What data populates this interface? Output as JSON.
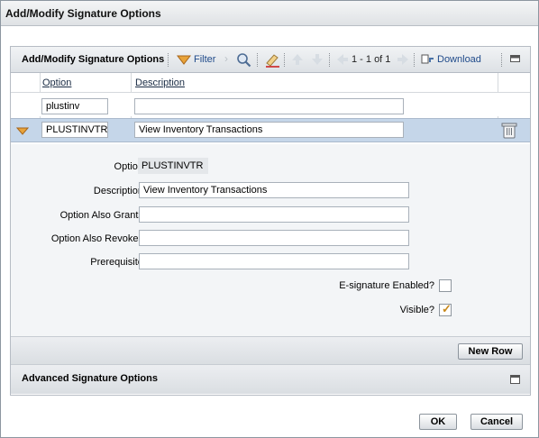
{
  "dialog": {
    "title": "Add/Modify Signature Options"
  },
  "toolbar": {
    "title": "Add/Modify Signature Options",
    "filter_label": "Filter",
    "pagination": "1 - 1 of 1",
    "download_label": "Download"
  },
  "columns": {
    "option": "Option",
    "description": "Description"
  },
  "filter_row": {
    "option": "plustinv",
    "description": ""
  },
  "selected_row": {
    "option": "PLUSTINVTR",
    "description": "View Inventory Transactions"
  },
  "detail": {
    "option_label": "Option:",
    "option_value": "PLUSTINVTR",
    "description_label": "Description:",
    "description_value": "View Inventory Transactions",
    "grants_label": "Option Also Grants:",
    "grants_value": "",
    "revokes_label": "Option Also Revokes:",
    "revokes_value": "",
    "prereq_label": "Prerequisite:",
    "prereq_value": "",
    "esig_label": "E-signature Enabled?",
    "esig_checked": false,
    "visible_label": "Visible?",
    "visible_checked": true
  },
  "new_row_label": "New Row",
  "advanced": {
    "title": "Advanced Signature Options"
  },
  "footer": {
    "ok_label": "OK",
    "cancel_label": "Cancel"
  },
  "colors": {
    "selected_row": "#c5d6e9",
    "link": "#1f4a8a",
    "accent": "#e8a33a"
  }
}
